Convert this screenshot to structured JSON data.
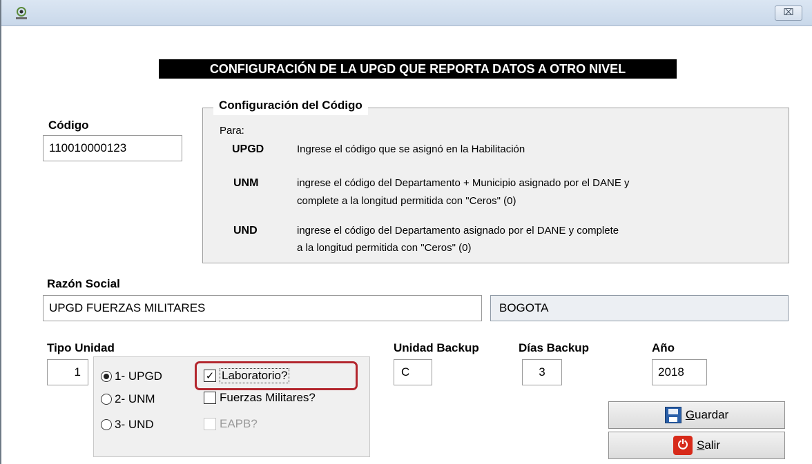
{
  "window": {
    "close_glyph": "⌧",
    "app_icon": "sivigila-icon"
  },
  "header": {
    "title": "CONFIGURACIÓN DE LA UPGD QUE REPORTA DATOS A OTRO NIVEL"
  },
  "codigo": {
    "label": "Código",
    "value": "110010000123"
  },
  "config_group": {
    "title": "Configuración del Código",
    "intro": "Para:",
    "entries": [
      {
        "code": "UPGD",
        "line1": "Ingrese el código que se asignó en la Habilitación",
        "line2": ""
      },
      {
        "code": "UNM",
        "line1": "ingrese el código del Departamento + Municipio asignado por el DANE y",
        "line2": "complete a la longitud permitida con \"Ceros\" (0)"
      },
      {
        "code": "UND",
        "line1": "ingrese el código del Departamento asignado por el DANE y complete",
        "line2": "a la longitud permitida con \"Ceros\" (0)"
      }
    ]
  },
  "razon_social": {
    "label": "Razón Social",
    "value": "UPGD FUERZAS MILITARES",
    "city": "BOGOTA"
  },
  "tipo_unidad": {
    "label": "Tipo Unidad",
    "value": "1",
    "options": [
      {
        "label": "1- UPGD",
        "selected": true
      },
      {
        "label": "2- UNM",
        "selected": false
      },
      {
        "label": "3- UND",
        "selected": false
      }
    ],
    "checkboxes": [
      {
        "label": "Laboratorio?",
        "checked": true,
        "enabled": true
      },
      {
        "label": "Fuerzas Militares?",
        "checked": false,
        "enabled": true
      },
      {
        "label": "EAPB?",
        "checked": false,
        "enabled": false
      }
    ]
  },
  "unidad_backup": {
    "label": "Unidad Backup",
    "value": "C"
  },
  "dias_backup": {
    "label": "Días Backup",
    "value": "3"
  },
  "anio": {
    "label": "Año",
    "value": "2018"
  },
  "buttons": {
    "save": {
      "mnemonic": "G",
      "rest": "uardar",
      "icon": "save-icon"
    },
    "exit": {
      "mnemonic": "S",
      "rest": "alir",
      "icon": "exit-icon"
    }
  },
  "colors": {
    "highlight": "#b3262e",
    "header_bg": "#000000",
    "exit_icon": "#d72a1a",
    "save_icon": "#2a5fa8"
  }
}
